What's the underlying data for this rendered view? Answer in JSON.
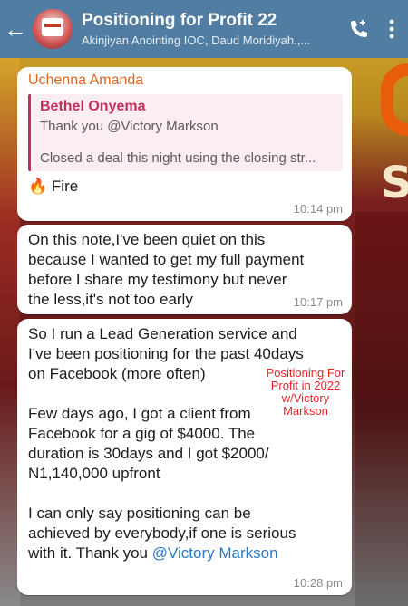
{
  "header": {
    "title": "Positioning for Profit 22",
    "members": "Akinjiyan Anointing IOC,  Daud Moridiyah.,..."
  },
  "messages": [
    {
      "sender": "Uchenna Amanda",
      "reply_name": "Bethel Onyema",
      "reply_line1": "Thank you @Victory Markson",
      "reply_line2": "Closed a deal this night using the closing str...",
      "text": "Fire",
      "time": "10:14 pm"
    },
    {
      "lines": [
        "On this note,I've been quiet on this",
        "because I wanted to get my full payment",
        "before I share my testimony but never",
        "the less,it's not too early"
      ],
      "time": "10:17 pm"
    },
    {
      "lines": [
        "So I run a Lead Generation service and",
        "I've been positioning for the past 40days",
        "on Facebook (more often)"
      ],
      "lines2": [
        "Few days ago, I got a client from",
        "Facebook for a gig of $4000. The",
        "duration is 30days and I got $2000/",
        "N1,140,000 upfront"
      ],
      "lines3": [
        "I can only say positioning can be",
        "achieved by everybody,if one is serious",
        "with it. Thank you "
      ],
      "mention": "@Victory Markson",
      "time": "10:28 pm"
    }
  ],
  "watermark": [
    "Positioning For",
    "Profit in 2022",
    "w/Victory",
    "Markson"
  ]
}
